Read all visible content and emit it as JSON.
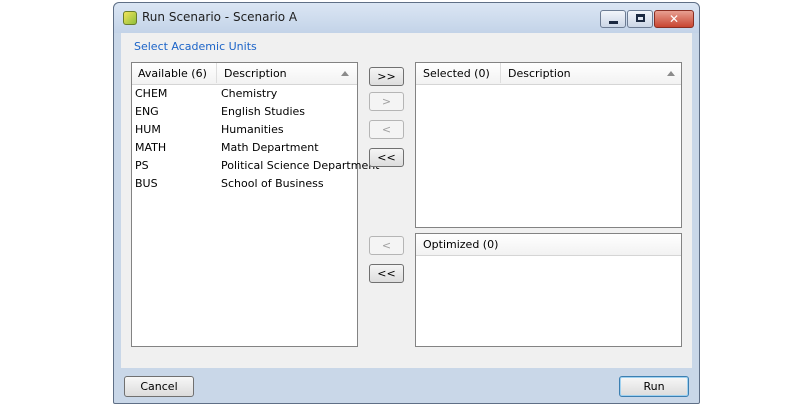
{
  "window": {
    "title": "Run Scenario - Scenario A",
    "close_glyph": "✕"
  },
  "section_label": "Select Academic  Units",
  "available": {
    "header_code": "Available (6)",
    "header_desc": "Description",
    "rows": [
      {
        "code": "CHEM",
        "desc": "Chemistry"
      },
      {
        "code": "ENG",
        "desc": "English Studies"
      },
      {
        "code": "HUM",
        "desc": "Humanities"
      },
      {
        "code": "MATH",
        "desc": "Math Department"
      },
      {
        "code": "PS",
        "desc": "Political Science Department"
      },
      {
        "code": "BUS",
        "desc": "School of Business"
      }
    ]
  },
  "selected": {
    "header_code": "Selected (0)",
    "header_desc": "Description"
  },
  "optimized": {
    "header": "Optimized (0)"
  },
  "move_buttons": {
    "add_all": ">>",
    "add_one": ">",
    "remove_one": "<",
    "remove_all": "<<",
    "opt_remove_one": "<",
    "opt_remove_all": "<<"
  },
  "footer": {
    "cancel": "Cancel",
    "run": "Run"
  }
}
